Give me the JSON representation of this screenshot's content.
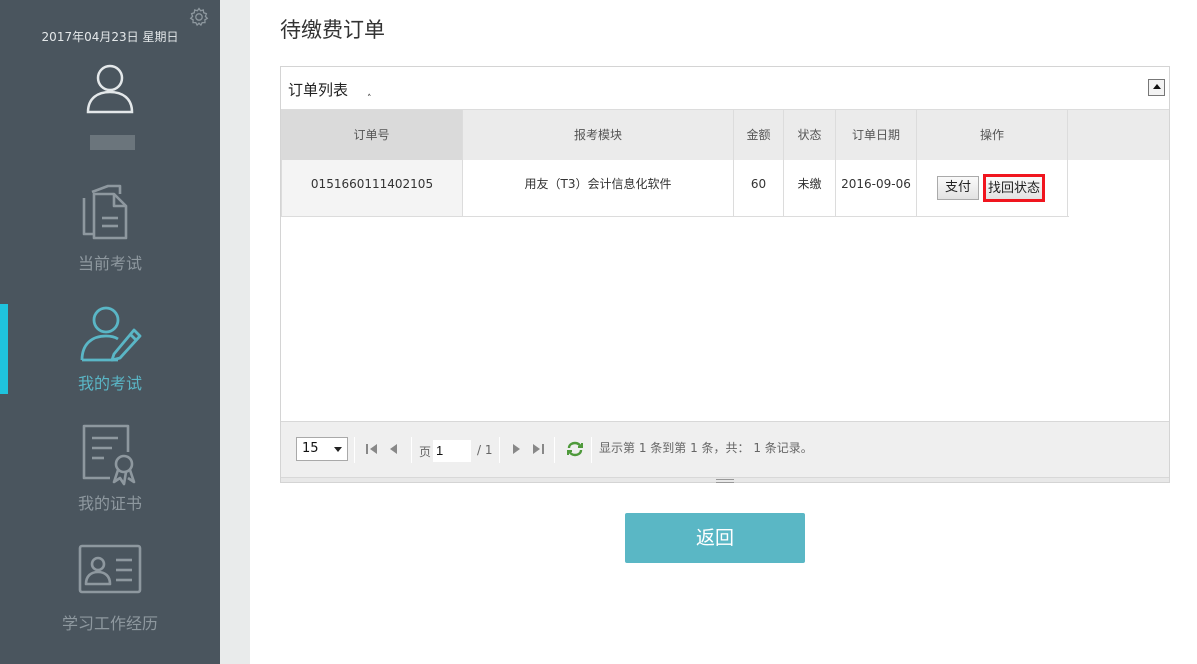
{
  "sidebar": {
    "date": "2017年04月23日 星期日",
    "nav": [
      {
        "label": "当前考试",
        "icon": "documents-icon"
      },
      {
        "label": "我的考试",
        "icon": "user-edit-icon"
      },
      {
        "label": "我的证书",
        "icon": "certificate-icon"
      },
      {
        "label": "学习工作经历",
        "icon": "id-card-icon"
      }
    ],
    "active_index": 1
  },
  "page": {
    "title": "待缴费订单"
  },
  "panel": {
    "title": "订单列表"
  },
  "table": {
    "columns": [
      "订单号",
      "报考模块",
      "金额",
      "状态",
      "订单日期",
      "操作"
    ],
    "rows": [
      {
        "order_no": "0151660111402105",
        "module": "用友（T3）会计信息化软件",
        "amount": "60",
        "status": "未缴",
        "date": "2016-09-06",
        "pay_label": "支付",
        "recover_label": "找回状态"
      }
    ]
  },
  "pager": {
    "page_size": "15",
    "page_label": "页",
    "current_page": "1",
    "total_pages": "/ 1",
    "summary": "显示第 1 条到第 1 条，共： 1 条记录。"
  },
  "back_label": "返回",
  "colors": {
    "sidebar_bg": "#4a555e",
    "accent": "#5ab7c5",
    "active_bar": "#1fc3dd",
    "highlight_border": "#f0151e"
  }
}
